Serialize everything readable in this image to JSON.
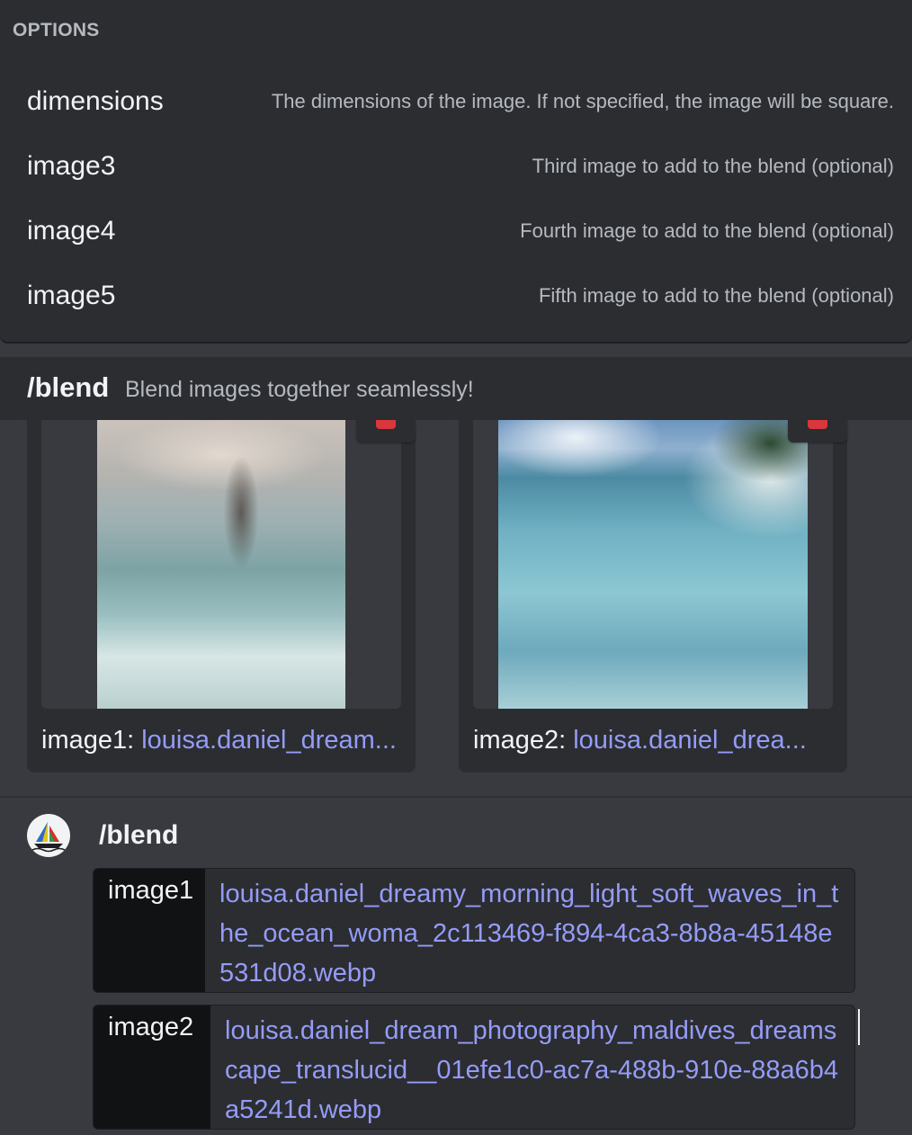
{
  "options": {
    "header": "OPTIONS",
    "items": [
      {
        "name": "dimensions",
        "description": "The dimensions of the image. If not specified, the image will be square."
      },
      {
        "name": "image3",
        "description": "Third image to add to the blend (optional)"
      },
      {
        "name": "image4",
        "description": "Fourth image to add to the blend (optional)"
      },
      {
        "name": "image5",
        "description": "Fifth image to add to the blend (optional)"
      }
    ]
  },
  "command": {
    "name": "/blend",
    "description": "Blend images together seamlessly!"
  },
  "attachments": [
    {
      "label": "image1:",
      "filename": "louisa.daniel_dream...",
      "image": "woman-walking-into-ocean-waves"
    },
    {
      "label": "image2:",
      "filename": "louisa.daniel_drea...",
      "image": "maldives-clear-water-beach"
    }
  ],
  "message": {
    "command": "/blend",
    "params": [
      {
        "key": "image1",
        "value": "louisa.daniel_dreamy_morning_light_soft_waves_in_the_ocean_woma_2c113469-f894-4ca3-8b8a-45148e531d08.webp"
      },
      {
        "key": "image2",
        "value": "louisa.daniel_dream_photography_maldives_dreamscape_translucid__01efe1c0-ac7a-488b-910e-88a6b4a5241d.webp"
      }
    ]
  },
  "icons": {
    "avatar": "midjourney-boat-icon",
    "delete": "trash-icon"
  },
  "colors": {
    "link": "#949cf7",
    "danger": "#da373c",
    "background": "#383a40",
    "panel": "#2b2d31"
  }
}
